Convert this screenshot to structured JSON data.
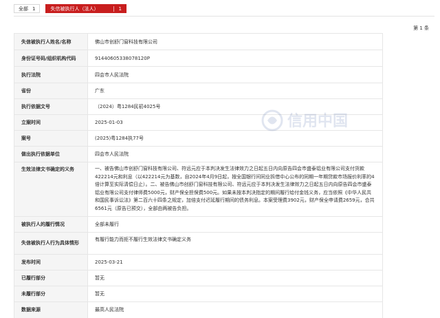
{
  "tabs": [
    {
      "label": "全部",
      "count": "1"
    },
    {
      "label": "失信被执行人（法人）",
      "count": "1"
    }
  ],
  "pagination": {
    "text": "第 1 条"
  },
  "rows": [
    {
      "key": "失信被执行人姓名/名称",
      "value": "佛山市创舒门窗科技有限公司"
    },
    {
      "key": "身份证号码/组织机构代码",
      "value": "91440605338078120P"
    },
    {
      "key": "执行法院",
      "value": "四会市人民法院"
    },
    {
      "key": "省份",
      "value": "广东"
    },
    {
      "key": "执行依据文号",
      "value": "（2024）粤1284民初4025号"
    },
    {
      "key": "立案时间",
      "value": "2025-01-03"
    },
    {
      "key": "案号",
      "value": "(2025)粤1284执77号"
    },
    {
      "key": "做出执行依据单位",
      "value": "四会市人民法院"
    },
    {
      "key": "生效法律文书确定的义务",
      "value": "一、被告佛山市创舒门窗科技有限公司、符远元应于本判决发生法律效力之日起五日内向原告四会市盛泰铝业有限公司支付货款422214元和利息（以422214元为基数，自2024年4月9日起，按全国银行间同业拆借中心公布的同期一年期贷款市场报价利率的4倍计算至实际清偿日止）。二、被告佛山市创舒门窗科技有限公司、符远元应于本判决发生法律效力之日起五日内向原告四会市盛泰铝业有限公司支付律师费5000元，财产保全担保费500元。如果未按本判决指定的期间履行给付金钱义务，应当依照《中华人民共和国民事诉讼法》第二百六十四条之规定，加倍支付迟延履行期间的债务利息。本案受理费3902元，财产保全申请费2659元，合共6561元（原告已预交），全部由两被告负担。"
    },
    {
      "key": "被执行人的履行情况",
      "value": "全部未履行"
    },
    {
      "key": "失信被执行人行为具体情形",
      "value": "有履行能力而拒不履行生效法律文书确定义务"
    },
    {
      "key": "发布时间",
      "value": "2025-03-21"
    },
    {
      "key": "已履行部分",
      "value": "暂无"
    },
    {
      "key": "未履行部分",
      "value": "暂无"
    },
    {
      "key": "数据来源",
      "value": "最高人民法院"
    }
  ],
  "watermark": {
    "text": "信用中国",
    "icon": "credit-china-logo-icon"
  },
  "colors": {
    "accent": "#c81e1e",
    "label_bg": "#f5f5f5",
    "border": "#e6e6e6"
  }
}
